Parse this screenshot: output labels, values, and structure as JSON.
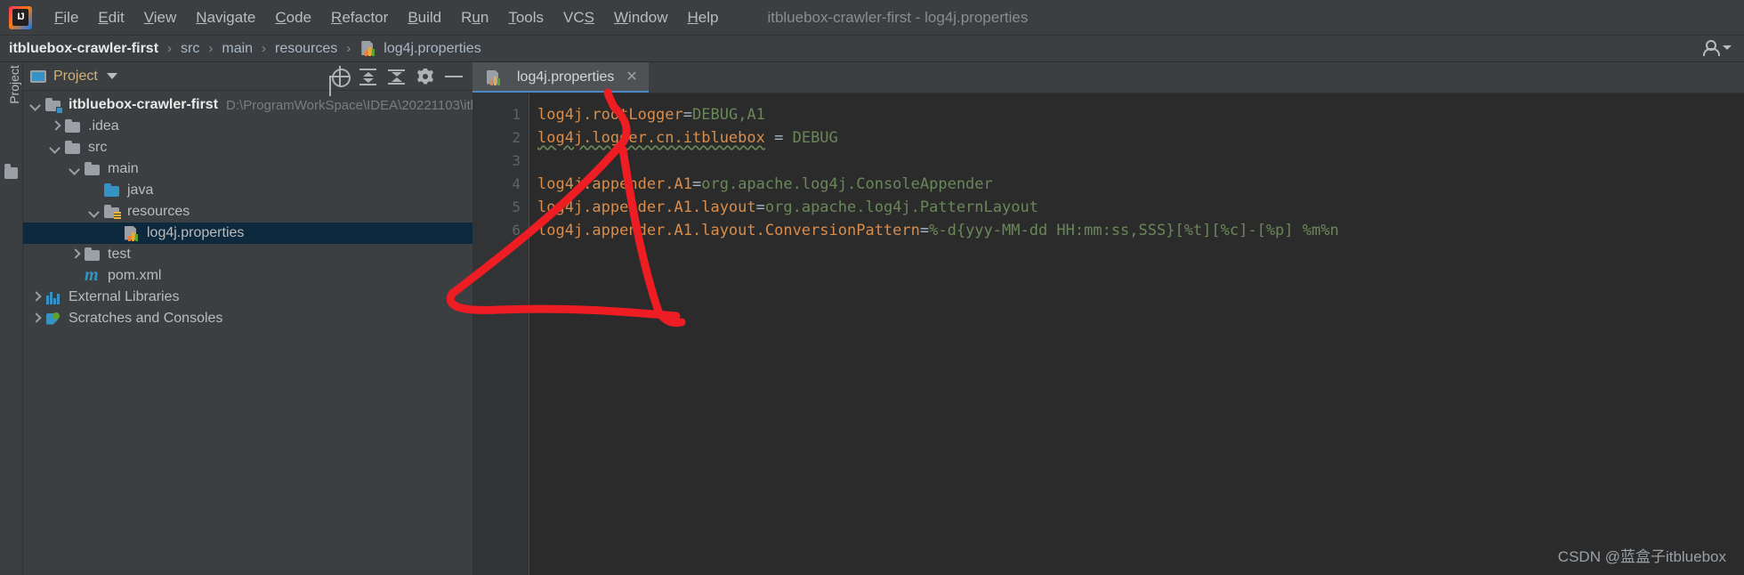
{
  "window": {
    "title": "itbluebox-crawler-first - log4j.properties",
    "logo_icon": "intellij-idea-logo"
  },
  "menubar": {
    "items": [
      {
        "label": "File",
        "mnemonic": "F"
      },
      {
        "label": "Edit",
        "mnemonic": "E"
      },
      {
        "label": "View",
        "mnemonic": "V"
      },
      {
        "label": "Navigate",
        "mnemonic": "N"
      },
      {
        "label": "Code",
        "mnemonic": "C"
      },
      {
        "label": "Refactor",
        "mnemonic": "R"
      },
      {
        "label": "Build",
        "mnemonic": "B"
      },
      {
        "label": "Run",
        "mnemonic": "u"
      },
      {
        "label": "Tools",
        "mnemonic": "T"
      },
      {
        "label": "VCS",
        "mnemonic": "S"
      },
      {
        "label": "Window",
        "mnemonic": "W"
      },
      {
        "label": "Help",
        "mnemonic": "H"
      }
    ]
  },
  "navbar": {
    "crumbs": [
      {
        "label": "itbluebox-crawler-first",
        "icon": "none"
      },
      {
        "label": "src",
        "icon": "none"
      },
      {
        "label": "main",
        "icon": "none"
      },
      {
        "label": "resources",
        "icon": "none"
      },
      {
        "label": "log4j.properties",
        "icon": "properties-file-icon"
      }
    ],
    "separator": "›",
    "account_icon": "user-account-icon",
    "account_caret_icon": "chevron-down-icon"
  },
  "left_strip": {
    "project_tab": "Project",
    "structure_icon": "structure-icon"
  },
  "project_panel": {
    "title": "Project",
    "title_icon": "project-window-icon",
    "title_caret_icon": "chevron-down-icon",
    "toolbar_buttons": [
      {
        "name": "locate-icon",
        "label": "Select Opened File"
      },
      {
        "name": "expand-all-icon",
        "label": "Expand All"
      },
      {
        "name": "collapse-all-icon",
        "label": "Collapse All"
      },
      {
        "name": "gear-icon",
        "label": "Show Options Menu"
      },
      {
        "name": "hide-icon",
        "label": "Hide"
      }
    ],
    "tree": [
      {
        "label": "itbluebox-crawler-first",
        "hint": "D:\\ProgramWorkSpace\\IDEA\\20221103\\itl",
        "indent": 0,
        "arrow": "down",
        "icon": "module-folder-icon",
        "bold": true,
        "selected": false
      },
      {
        "label": ".idea",
        "hint": "",
        "indent": 1,
        "arrow": "right",
        "icon": "folder-icon",
        "bold": false,
        "selected": false
      },
      {
        "label": "src",
        "hint": "",
        "indent": 1,
        "arrow": "down",
        "icon": "folder-icon",
        "bold": false,
        "selected": false
      },
      {
        "label": "main",
        "hint": "",
        "indent": 2,
        "arrow": "down",
        "icon": "folder-icon",
        "bold": false,
        "selected": false
      },
      {
        "label": "java",
        "hint": "",
        "indent": 3,
        "arrow": "none",
        "icon": "source-folder-icon",
        "bold": false,
        "selected": false
      },
      {
        "label": "resources",
        "hint": "",
        "indent": 3,
        "arrow": "down",
        "icon": "resources-folder-icon",
        "bold": false,
        "selected": false
      },
      {
        "label": "log4j.properties",
        "hint": "",
        "indent": 4,
        "arrow": "none",
        "icon": "properties-file-icon",
        "bold": false,
        "selected": true
      },
      {
        "label": "test",
        "hint": "",
        "indent": 2,
        "arrow": "right",
        "icon": "folder-icon",
        "bold": false,
        "selected": false
      },
      {
        "label": "pom.xml",
        "hint": "",
        "indent": 2,
        "arrow": "none",
        "icon": "maven-file-icon",
        "bold": false,
        "selected": false
      },
      {
        "label": "External Libraries",
        "hint": "",
        "indent": 0,
        "arrow": "right",
        "icon": "libraries-icon",
        "bold": false,
        "selected": false
      },
      {
        "label": "Scratches and Consoles",
        "hint": "",
        "indent": 0,
        "arrow": "right",
        "icon": "scratches-icon",
        "bold": false,
        "selected": false
      }
    ]
  },
  "editor": {
    "tab": {
      "label": "log4j.properties",
      "icon": "properties-file-icon",
      "close_icon": "close-icon",
      "active": true
    },
    "line_numbers": [
      "1",
      "2",
      "3",
      "4",
      "5",
      "6"
    ],
    "lines": [
      {
        "num": "1",
        "key": "log4j.rootLogger",
        "eq": "=",
        "value": "DEBUG,A1",
        "underline": false,
        "spaced": false
      },
      {
        "num": "2",
        "key": "log4j.logger.cn.itbluebox",
        "eq": " = ",
        "value": "DEBUG",
        "underline": true,
        "spaced": true
      },
      {
        "num": "3",
        "key": "",
        "eq": "",
        "value": "",
        "underline": false,
        "spaced": false
      },
      {
        "num": "4",
        "key": "log4j.appender.A1",
        "eq": "=",
        "value": "org.apache.log4j.ConsoleAppender",
        "underline": false,
        "spaced": false
      },
      {
        "num": "5",
        "key": "log4j.appender.A1.layout",
        "eq": "=",
        "value": "org.apache.log4j.PatternLayout",
        "underline": false,
        "spaced": false
      },
      {
        "num": "6",
        "key": "log4j.appender.A1.layout.ConversionPattern",
        "eq": "=",
        "value": "%-d{yyy-MM-dd HH:mm:ss,SSS}[%t][%c]-[%p] %m%n",
        "underline": false,
        "spaced": false
      }
    ]
  },
  "annotation": {
    "color": "#ee1c23",
    "description": "red hand-drawn arrow from log4j.properties tree node to editor tab"
  },
  "watermark": {
    "text": "CSDN @蓝盒子itbluebox"
  },
  "colors": {
    "chrome_bg": "#3c3f41",
    "editor_bg": "#2b2b2b",
    "gutter_bg": "#313335",
    "selection_bg": "#0d293e",
    "key_color": "#d98d4c",
    "value_color": "#6a8759",
    "tab_active_bg": "#4e5254",
    "tab_underline": "#4a88c7"
  }
}
